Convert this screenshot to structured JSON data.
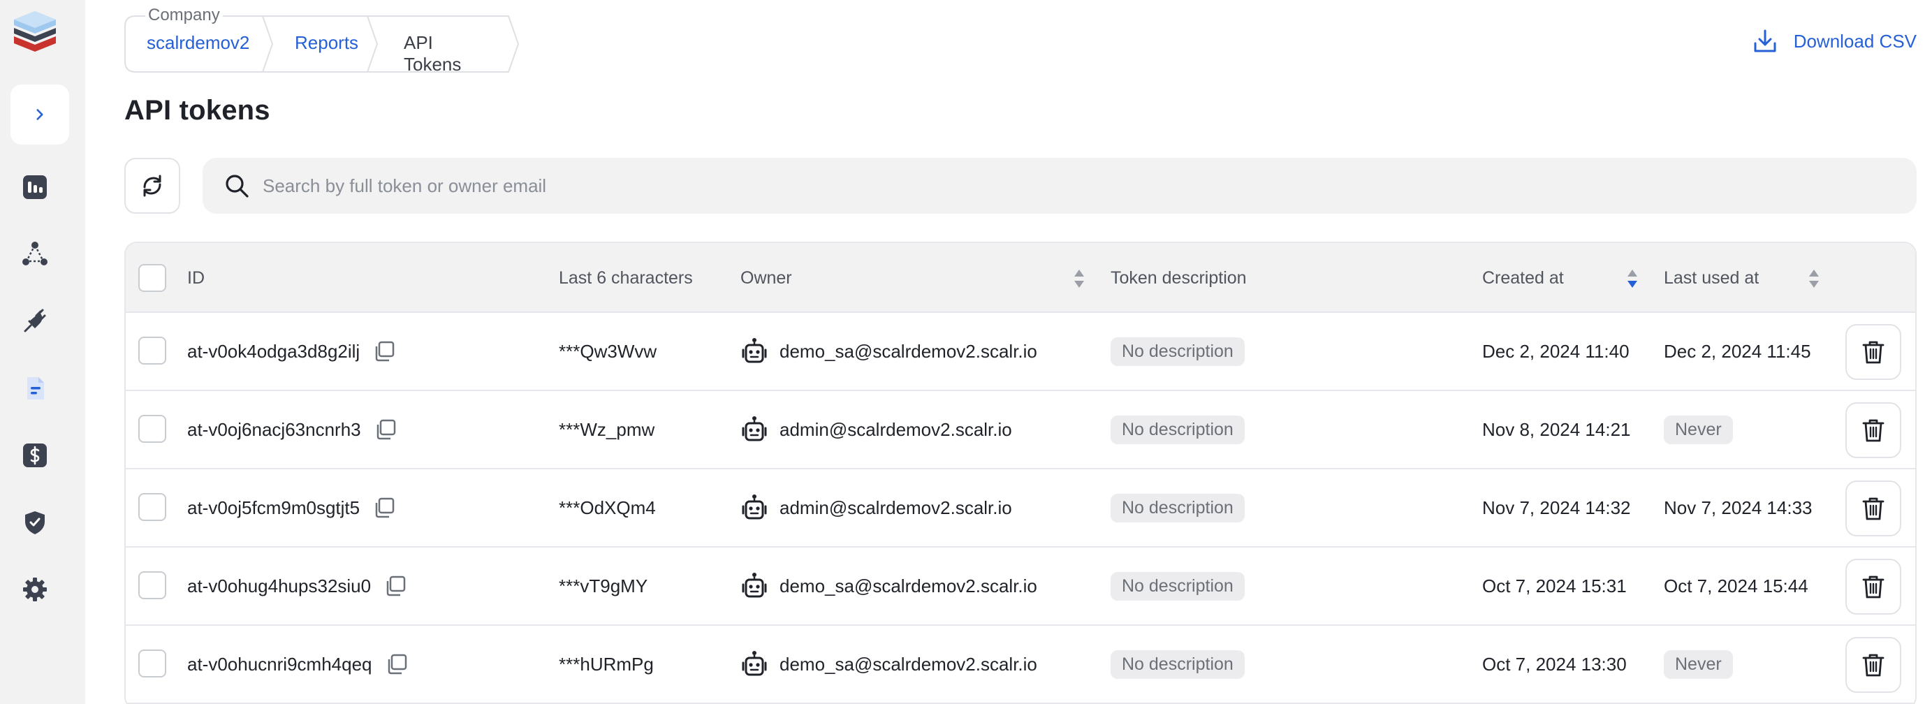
{
  "breadcrumb": {
    "group_label": "Company",
    "items": [
      "scalrdemov2",
      "Reports",
      "API Tokens"
    ]
  },
  "actions": {
    "download_label": "Download CSV"
  },
  "page_title": "API tokens",
  "search": {
    "placeholder": "Search by full token or owner email"
  },
  "table": {
    "headers": {
      "id": "ID",
      "last6": "Last 6 characters",
      "owner": "Owner",
      "description": "Token description",
      "created": "Created at",
      "last_used": "Last used at"
    },
    "rows": [
      {
        "id": "at-v0ok4odga3d8g2ilj",
        "last6": "***Qw3Wvw",
        "owner": "demo_sa@scalrdemov2.scalr.io",
        "description": "No description",
        "created": "Dec 2, 2024 11:40",
        "last_used": "Dec 2, 2024 11:45"
      },
      {
        "id": "at-v0oj6nacj63ncnrh3",
        "last6": "***Wz_pmw",
        "owner": "admin@scalrdemov2.scalr.io",
        "description": "No description",
        "created": "Nov 8, 2024 14:21",
        "last_used": "Never"
      },
      {
        "id": "at-v0oj5fcm9m0sgtjt5",
        "last6": "***OdXQm4",
        "owner": "admin@scalrdemov2.scalr.io",
        "description": "No description",
        "created": "Nov 7, 2024 14:32",
        "last_used": "Nov 7, 2024 14:33"
      },
      {
        "id": "at-v0ohug4hups32siu0",
        "last6": "***vT9gMY",
        "owner": "demo_sa@scalrdemov2.scalr.io",
        "description": "No description",
        "created": "Oct 7, 2024 15:31",
        "last_used": "Oct 7, 2024 15:44"
      },
      {
        "id": "at-v0ohucnri9cmh4qeq",
        "last6": "***hURmPg",
        "owner": "demo_sa@scalrdemov2.scalr.io",
        "description": "No description",
        "created": "Oct 7, 2024 13:30",
        "last_used": "Never"
      }
    ]
  },
  "colors": {
    "accent": "#2660d6",
    "sidebar_bg": "#f2f2f3",
    "header_bg": "#f2f2f3",
    "pill_bg": "#ececee"
  },
  "icons": [
    "scalr-logo-icon",
    "chevron-right-icon",
    "dashboard-icon",
    "nodes-icon",
    "plug-icon",
    "reports-icon",
    "billing-icon",
    "shield-icon",
    "gear-icon",
    "download-icon",
    "refresh-icon",
    "search-icon",
    "copy-icon",
    "robot-icon",
    "trash-icon"
  ]
}
